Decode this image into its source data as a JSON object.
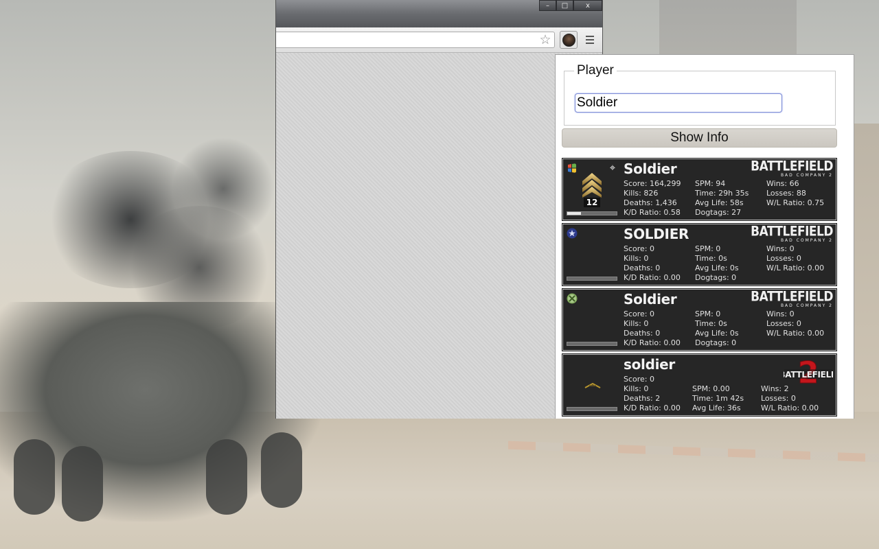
{
  "window": {
    "controls": {
      "minimize": "–",
      "maximize": "□",
      "close": "x"
    }
  },
  "toolbar": {
    "omnibox_value": "",
    "star_icon": "star-icon",
    "extension_icon": "soldier-avatar-icon",
    "menu_icon": "menu-icon"
  },
  "popup": {
    "player_legend": "Player",
    "player_input_value": "Soldier",
    "show_info_label": "Show Info",
    "cards": [
      {
        "platform": "pc",
        "name": "Soldier",
        "game": "BATTLEFIELD",
        "game_sub": "BAD COMPANY 2",
        "rank_number": "12",
        "progress": 0.28,
        "col1": [
          "Score: 164,299",
          "Kills: 826",
          "Deaths: 1,436",
          "K/D Ratio: 0.58"
        ],
        "col2": [
          "SPM: 94",
          "Time: 29h 35s",
          "Avg Life: 58s",
          "Dogtags: 27"
        ],
        "col3": [
          "Wins: 66",
          "Losses: 88",
          "W/L Ratio: 0.75"
        ]
      },
      {
        "platform": "ps3",
        "name": "SOLDIER",
        "game": "BATTLEFIELD",
        "game_sub": "BAD COMPANY 2",
        "progress": 0.0,
        "col1": [
          "Score: 0",
          "Kills: 0",
          "Deaths: 0",
          "K/D Ratio: 0.00"
        ],
        "col2": [
          "SPM: 0",
          "Time: 0s",
          "Avg Life: 0s",
          "Dogtags: 0"
        ],
        "col3": [
          "Wins: 0",
          "Losses: 0",
          "W/L Ratio: 0.00"
        ]
      },
      {
        "platform": "xbox",
        "name": "Soldier",
        "game": "BATTLEFIELD",
        "game_sub": "BAD COMPANY 2",
        "progress": 0.0,
        "col1": [
          "Score: 0",
          "Kills: 0",
          "Deaths: 0",
          "K/D Ratio: 0.00"
        ],
        "col2": [
          "SPM: 0",
          "Time: 0s",
          "Avg Life: 0s",
          "Dogtags: 0"
        ],
        "col3": [
          "Wins: 0",
          "Losses: 0",
          "W/L Ratio: 0.00"
        ]
      },
      {
        "platform": "bf2",
        "name": "soldier",
        "game": "BATTLEFIELD",
        "game_number": "2",
        "progress": 0.0,
        "col1": [
          "Score: 0",
          "Kills: 0",
          "Deaths: 2",
          "K/D Ratio: 0.00"
        ],
        "col2": [
          "SPM: 0.00",
          "Time: 1m 42s",
          "Avg Life: 36s"
        ],
        "col3": [
          "Wins: 2",
          "Losses: 0",
          "W/L Ratio: 0.00"
        ]
      }
    ]
  },
  "colors": {
    "card_bg": "#262626",
    "input_focus": "#7b8bd6",
    "button_bg": "#d2cfc9"
  }
}
